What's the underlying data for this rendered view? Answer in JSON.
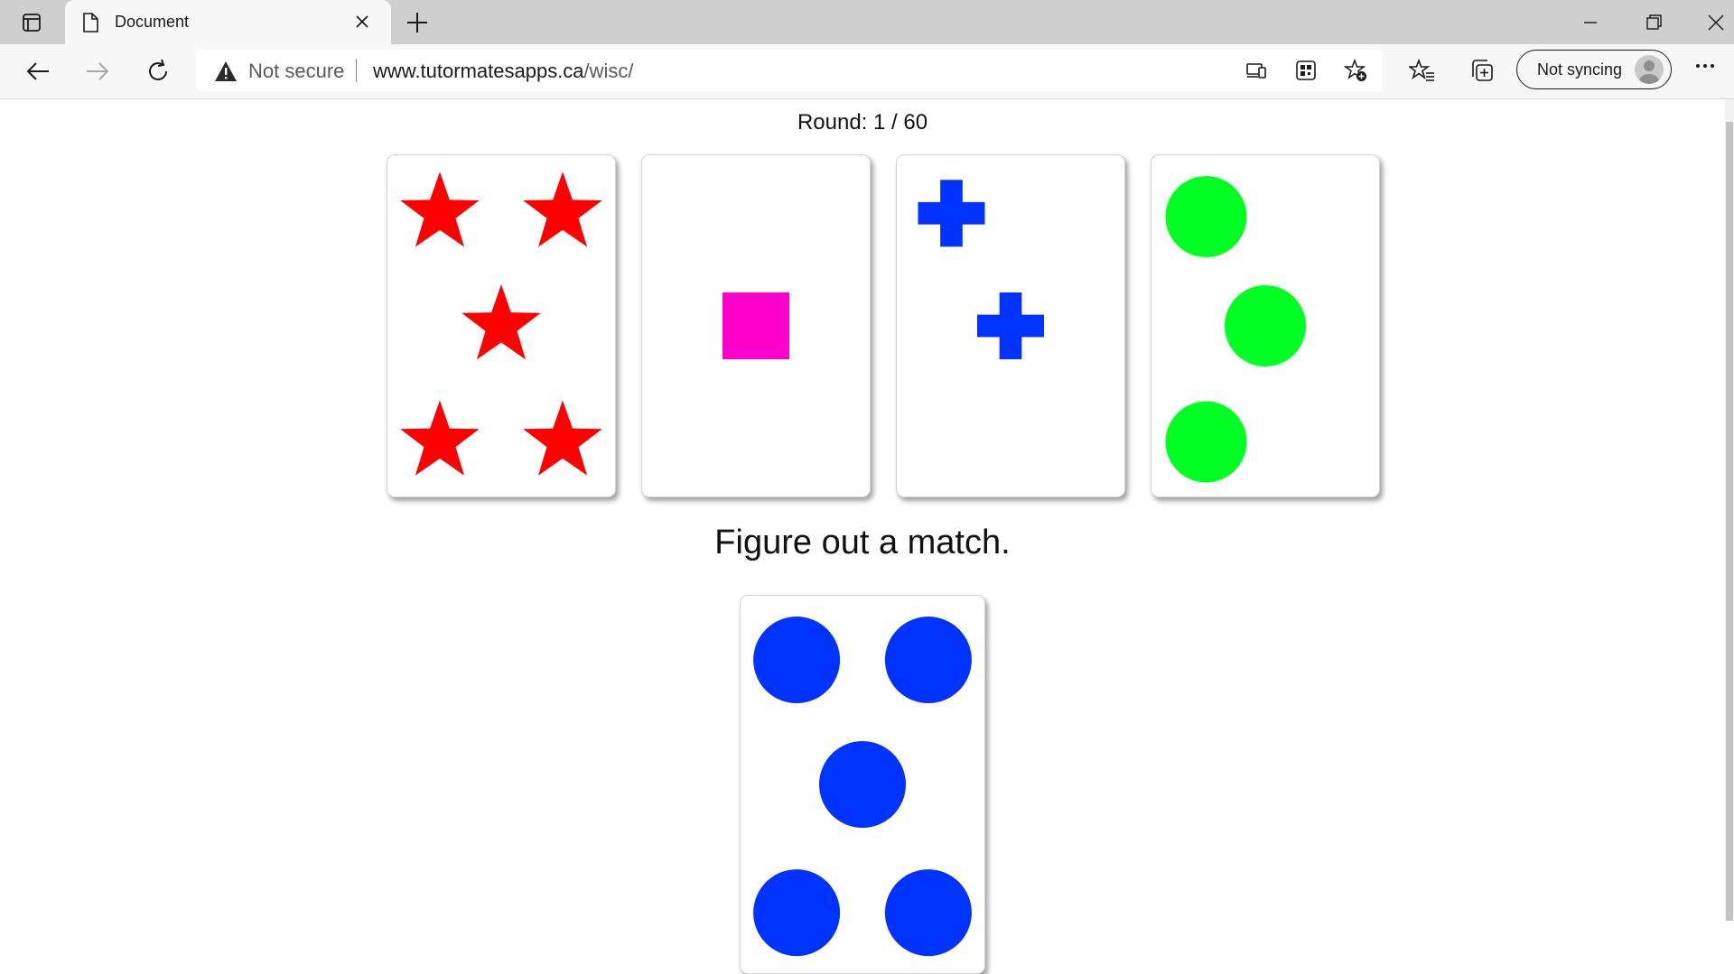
{
  "browser": {
    "tab_title": "Document",
    "security_label": "Not secure",
    "url_host": "www.tutormatesapps.ca",
    "url_path": "/wisc/",
    "profile_label": "Not syncing"
  },
  "game": {
    "round_text": "Round: 1 / 60",
    "instruction": "Figure out a match.",
    "key_cards": [
      {
        "shape": "star",
        "color": "#ff0000",
        "count": 5
      },
      {
        "shape": "square",
        "color": "#ff00cc",
        "count": 1
      },
      {
        "shape": "cross",
        "color": "#0033ff",
        "count": 2
      },
      {
        "shape": "circle",
        "color": "#00ff22",
        "count": 3
      }
    ],
    "response_card": {
      "shape": "circle",
      "color": "#0033ff",
      "count": 5
    }
  }
}
